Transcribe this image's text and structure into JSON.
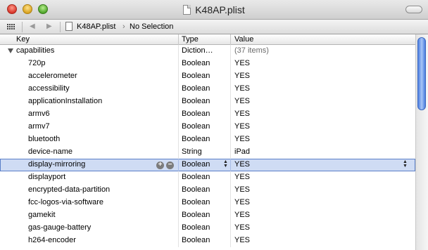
{
  "window": {
    "title": "K48AP.plist"
  },
  "pathbar": {
    "file": "K48AP.plist",
    "selection": "No Selection"
  },
  "columns": {
    "key": "Key",
    "type": "Type",
    "value": "Value"
  },
  "root": {
    "key": "capabilities",
    "type": "Diction…",
    "value": "(37 items)"
  },
  "rows": [
    {
      "key": "720p",
      "type": "Boolean",
      "value": "YES"
    },
    {
      "key": "accelerometer",
      "type": "Boolean",
      "value": "YES"
    },
    {
      "key": "accessibility",
      "type": "Boolean",
      "value": "YES"
    },
    {
      "key": "applicationInstallation",
      "type": "Boolean",
      "value": "YES"
    },
    {
      "key": "armv6",
      "type": "Boolean",
      "value": "YES"
    },
    {
      "key": "armv7",
      "type": "Boolean",
      "value": "YES"
    },
    {
      "key": "bluetooth",
      "type": "Boolean",
      "value": "YES"
    },
    {
      "key": "device-name",
      "type": "String",
      "value": "iPad"
    },
    {
      "key": "display-mirroring",
      "type": "Boolean",
      "value": "YES"
    },
    {
      "key": "displayport",
      "type": "Boolean",
      "value": "YES"
    },
    {
      "key": "encrypted-data-partition",
      "type": "Boolean",
      "value": "YES"
    },
    {
      "key": "fcc-logos-via-software",
      "type": "Boolean",
      "value": "YES"
    },
    {
      "key": "gamekit",
      "type": "Boolean",
      "value": "YES"
    },
    {
      "key": "gas-gauge-battery",
      "type": "Boolean",
      "value": "YES"
    },
    {
      "key": "h264-encoder",
      "type": "Boolean",
      "value": "YES"
    }
  ],
  "controls": {
    "add": "+",
    "remove": "−",
    "nav_back": "◀",
    "nav_forward": "▶",
    "path_separator": "›"
  },
  "colors": {
    "selection": "#cfdcf4",
    "scroll_thumb": "#4c7ee0"
  }
}
